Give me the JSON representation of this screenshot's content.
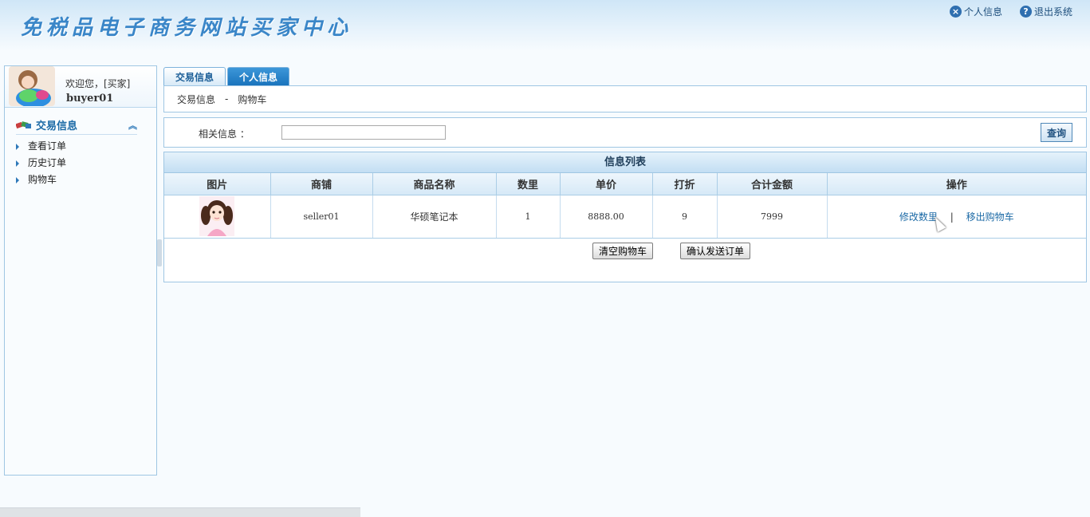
{
  "header": {
    "site_title": "免税品电子商务网站买家中心",
    "links": [
      {
        "label": "个人信息",
        "icon": "x-circle-icon"
      },
      {
        "label": "退出系统",
        "icon": "help-circle-icon"
      }
    ]
  },
  "sidebar": {
    "welcome": "欢迎您，[买家]",
    "username": "buyer01",
    "menu_title": "交易信息",
    "items": [
      "查看订单",
      "历史订单",
      "购物车"
    ]
  },
  "tabs": [
    "交易信息",
    "个人信息"
  ],
  "breadcrumb": {
    "section": "交易信息",
    "separator": "-",
    "page": "购物车"
  },
  "search": {
    "label": "相关信息 ：",
    "value": "",
    "button": "查询"
  },
  "list": {
    "title": "信息列表",
    "columns": [
      "图片",
      "商铺",
      "商品名称",
      "数里",
      "单价",
      "打折",
      "合计金额",
      "操作"
    ],
    "rows": [
      {
        "shop": "seller01",
        "product": "华硕笔记本",
        "qty": "1",
        "price": "8888.00",
        "discount": "9",
        "total": "7999",
        "op_edit": "修改数里",
        "op_sep": "|",
        "op_remove": "移出购物车"
      }
    ]
  },
  "actions": {
    "clear": "清空购物车",
    "confirm": "确认发送订单"
  },
  "colors": {
    "accent": "#1872bb",
    "border": "#9fc6e3",
    "link": "#1c6aa6"
  }
}
